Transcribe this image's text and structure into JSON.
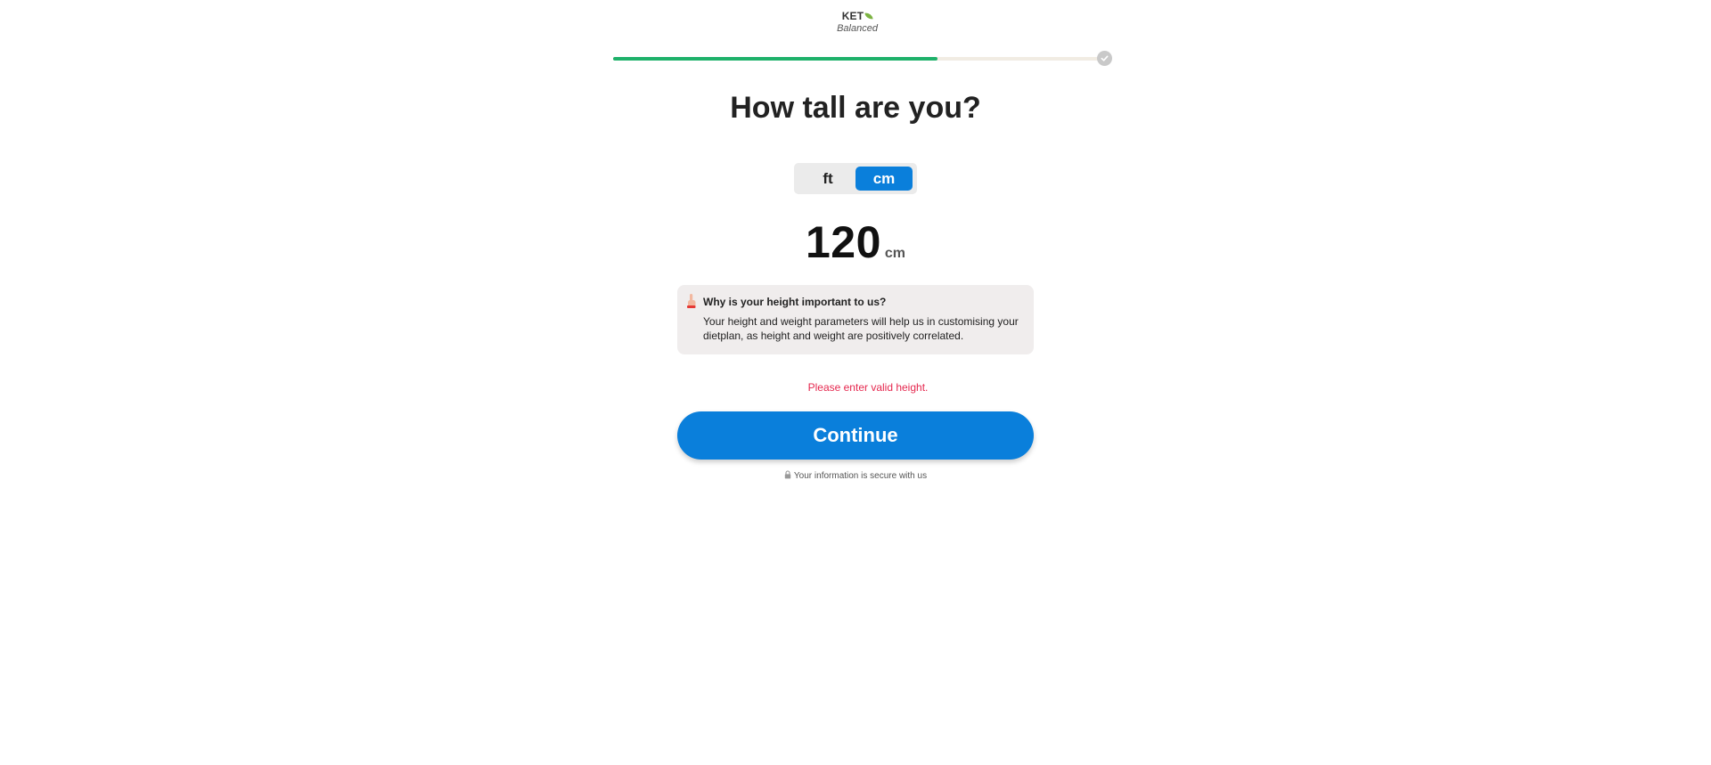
{
  "logo": {
    "top": "KETO",
    "bottom": "Balanced"
  },
  "progress": {
    "value": 0.66
  },
  "heading": "How tall are you?",
  "units": {
    "ft_label": "ft",
    "cm_label": "cm",
    "selected": "cm"
  },
  "height": {
    "value": "120",
    "unit": "cm"
  },
  "info": {
    "icon": "pointing-finger-icon",
    "title": "Why is your height important to us?",
    "text": "Your height and weight parameters will help us in customising your dietplan, as height and weight are positively correlated."
  },
  "error": "Please enter valid height.",
  "continue_label": "Continue",
  "secure_note": "Your information is secure with us",
  "colors": {
    "accent": "#0a7fdb",
    "progress": "#1eb16a",
    "error": "#e5274e",
    "info_bg": "#f0eded"
  }
}
